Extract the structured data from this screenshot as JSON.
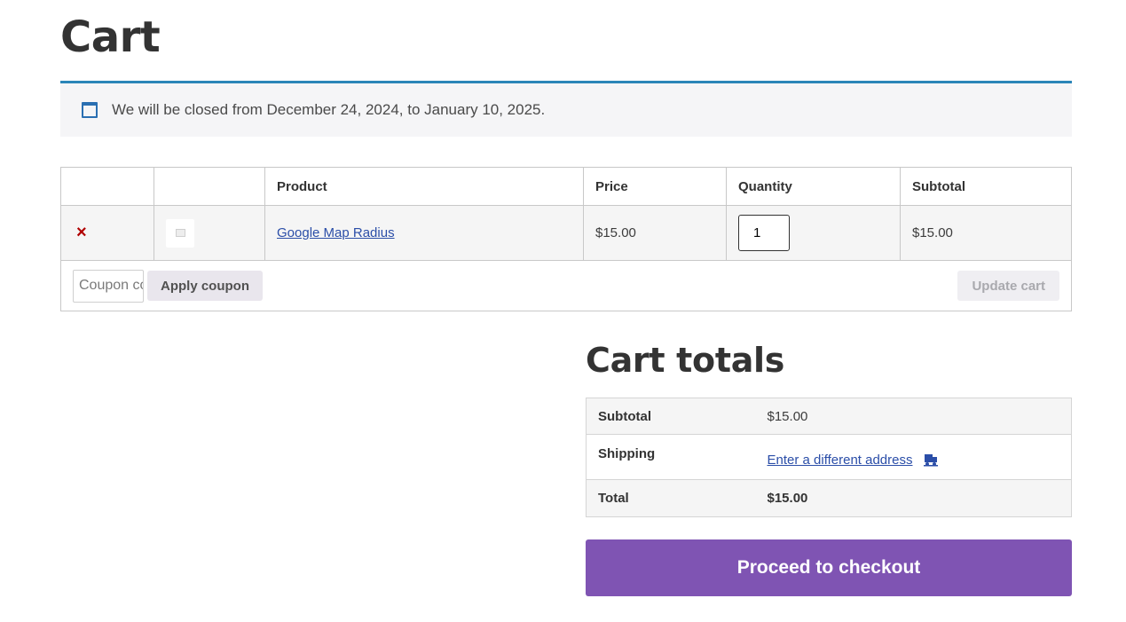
{
  "page": {
    "title": "Cart"
  },
  "notice": {
    "icon": "calendar-icon",
    "text": "We will be closed from December 24, 2024, to January 10, 2025."
  },
  "cart_table": {
    "headers": [
      "",
      "",
      "Product",
      "Price",
      "Quantity",
      "Subtotal"
    ],
    "items": [
      {
        "remove_symbol": "×",
        "thumbnail_icon": "image-placeholder-icon",
        "product": "Google Map Radius",
        "price": "$15.00",
        "quantity": "1",
        "subtotal": "$15.00"
      }
    ]
  },
  "coupon": {
    "placeholder": "Coupon code",
    "apply_label": "Apply coupon"
  },
  "update_label": "Update cart",
  "totals": {
    "title": "Cart totals",
    "subtotal_label": "Subtotal",
    "subtotal_value": "$15.00",
    "shipping_label": "Shipping",
    "shipping_link": "Enter a different address",
    "shipping_icon": "truck-icon",
    "total_label": "Total",
    "total_value": "$15.00"
  },
  "checkout_label": "Proceed to checkout",
  "colors": {
    "accent": "#7f54b3",
    "notice_border": "#2a85b8",
    "remove": "#b00000",
    "link": "#2b4ea8"
  }
}
